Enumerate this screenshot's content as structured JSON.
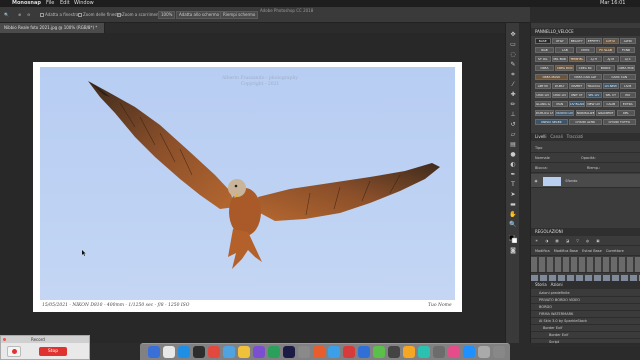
{
  "menubar": {
    "app_name": "Monosnap",
    "items": [
      "File",
      "Edit",
      "Window"
    ],
    "clock": "Mar 16:01"
  },
  "app_title": "Adobe Photoshop CC 2018",
  "options_bar": {
    "fit_label": "Adatta a finestra",
    "zoom_all_windows": "Zoom delle finestre",
    "scrubby_zoom": "Zoom a scorrimento",
    "zoom_100": "100%",
    "fit_screen": "Adatta allo schermo",
    "fill_screen": "Riempi schermo"
  },
  "document_tab": "Nibbio Reale foto 2021.jpg @ 100% (RGB/8*) *",
  "photo": {
    "watermark_line1": "Alberto Frassanito - photography",
    "watermark_line2": "Copyright - 2021",
    "caption_left": "15/05/2021 - NIKON D810 - 400mm - 1/1250 sec - f/8 - 1250 ISO",
    "caption_right": "Tuo Nome"
  },
  "right_panel": {
    "panel_title": "PANNELLO_VELOCE",
    "button_rows": [
      [
        "BASE",
        "UTILY",
        "BEAUTY",
        "EFFETTI",
        "LUT/V.",
        "ALTRI"
      ],
      [
        "RGB",
        "LAB",
        "CMYK",
        "FC SLAB",
        "FCNR"
      ],
      [
        "ST OG",
        "MIL BOR",
        "TEMP BL",
        "AJ H",
        "AJ M",
        "AJ C"
      ],
      [
        "CREA",
        "CREA DOC",
        "CREA RC",
        "BORDI",
        "CREA POR"
      ],
      [
        "CREA MASK",
        "CREA CAN ALP",
        "CANC CAN"
      ],
      [
        "APP MI",
        "DUPLY",
        "INVERT",
        "TRACCIA",
        "LIV.NEW",
        "LIV.B"
      ],
      [
        "UNIC LIV",
        "UNIC LIV",
        "UNIT CT",
        "SEL LIV",
        "SEL CT",
        "PIX"
      ],
      [
        "GLANG GROUP",
        "IPAN",
        "LIV BLANC",
        "NEW LIV",
        "CALIB",
        "EXTRA"
      ],
      [
        "DUPLICA LIVELLO",
        "NUOVO LIVELLO",
        "NORMALIZE",
        "GRADIENT",
        "DEL"
      ],
      [
        "UNISCI SELEZ",
        "CHIUDI ALTRI",
        "CHIUDI TUTTO"
      ]
    ],
    "layers_tabs": [
      "Livelli",
      "Canali",
      "Tracciati"
    ],
    "layer_filter": "Tipo",
    "blend_mode": "Normale",
    "opacity_label": "Opacità:",
    "lock_label": "Blocca:",
    "fill_label": "Riemp.:",
    "background_layer": "Sfondo",
    "adjust_title": "REGOLAZIONI",
    "modifica_tabs": [
      "Modifica",
      "Modifica Base",
      "Estrai Base",
      "Correttore"
    ],
    "actions_tabs": [
      "Storia",
      "Azioni"
    ],
    "actions": [
      "Azioni predefinite",
      "PRIVATO BORDO VIDEO",
      "BORDO",
      "FIRMA WATERMARK",
      "AI Skin 3.0 by SparkleStock",
      "Border Exif",
      "Border Exif",
      "Script"
    ]
  },
  "record_window": {
    "title": "Record",
    "stop_label": "Stop"
  },
  "colors": {
    "ps_bg": "#282828",
    "panel_bg": "#3b3b3b",
    "sky_blue": "#bed2f3",
    "stop_red": "#e0322f"
  }
}
